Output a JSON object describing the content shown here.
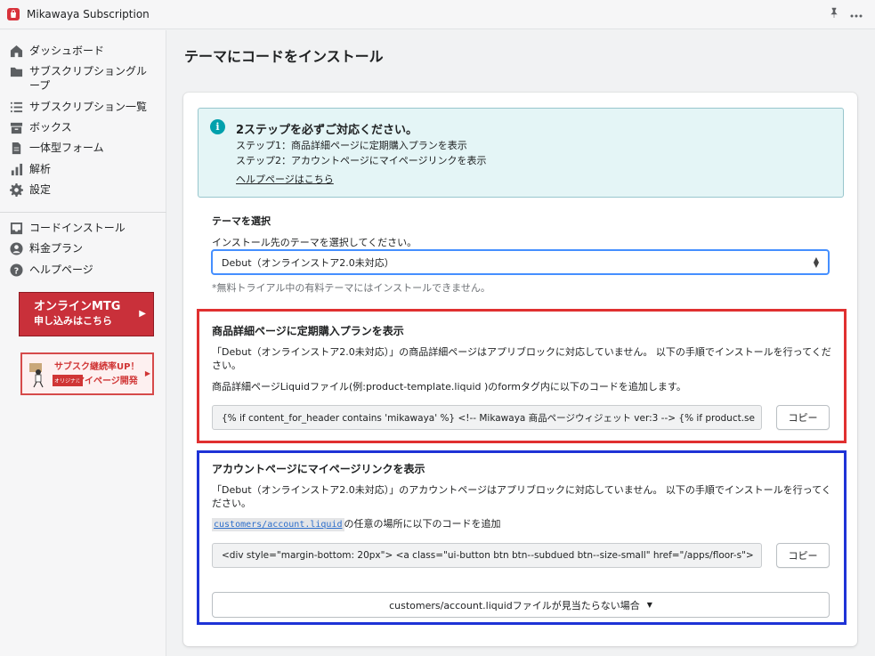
{
  "app": {
    "title": "Mikawaya Subscription",
    "logo_icon": "shopping-bag-icon",
    "accent": "#d8323b"
  },
  "sidebar": {
    "items": [
      {
        "label": "ダッシュボード",
        "icon": "home-icon"
      },
      {
        "label": "サブスクリプショングループ",
        "icon": "folder-icon"
      },
      {
        "label": "サブスクリプション一覧",
        "icon": "list-icon"
      },
      {
        "label": "ボックス",
        "icon": "box-icon"
      },
      {
        "label": "一体型フォーム",
        "icon": "form-icon"
      },
      {
        "label": "解析",
        "icon": "analytics-icon"
      },
      {
        "label": "設定",
        "icon": "gear-icon"
      }
    ],
    "items_secondary": [
      {
        "label": "コードインストール",
        "icon": "install-icon"
      },
      {
        "label": "料金プラン",
        "icon": "user-icon"
      },
      {
        "label": "ヘルプページ",
        "icon": "help-icon"
      }
    ],
    "banner_mtg": {
      "line1": "オンラインMTG",
      "line2": "申し込みはこちら"
    },
    "banner_mypage": {
      "line1": "サブスク継続率UP！",
      "tag": "オリジナル",
      "line2": "マイページ開発"
    }
  },
  "main": {
    "page_title": "テーマにコードをインストール",
    "callout": {
      "title": "2ステップを必ずご対応ください。",
      "step1": "ステップ1：商品詳細ページに定期購入プランを表示",
      "step2": "ステップ2：アカウントページにマイページリンクを表示",
      "link": "ヘルプページはこちら"
    },
    "theme": {
      "label": "テーマを選択",
      "help": "インストール先のテーマを選択してください。",
      "selected": "Debut（オンラインストア2.0未対応）",
      "note": "*無料トライアル中の有料テーマにはインストールできません。"
    },
    "product_section": {
      "title": "商品詳細ページに定期購入プランを表示",
      "desc": "「Debut（オンラインストア2.0未対応）」の商品詳細ページはアプリブロックに対応していません。 以下の手順でインストールを行ってください。",
      "instruction": "商品詳細ページLiquidファイル(例:product-template.liquid )のformタグ内に以下のコードを追加します。",
      "code": "{% if content_for_header contains 'mikawaya' %}  <!-- Mikawaya 商品ページウィジェット ver:3 -->  {% if product.se",
      "copy_label": "コピー"
    },
    "account_section": {
      "title": "アカウントページにマイページリンクを表示",
      "desc": "「Debut（オンラインストア2.0未対応）」のアカウントページはアプリブロックに対応していません。 以下の手順でインストールを行ってください。",
      "file_path": "customers/account.liquid",
      "instruction_suffix": "の任意の場所に以下のコードを追加",
      "code": "<div style=\"margin-bottom: 20px\">  <a class=\"ui-button btn btn--subdued btn--size-small\" href=\"/apps/floor-s\">",
      "copy_label": "コピー",
      "fallback_label": "customers/account.liquidファイルが見当たらない場合"
    }
  }
}
